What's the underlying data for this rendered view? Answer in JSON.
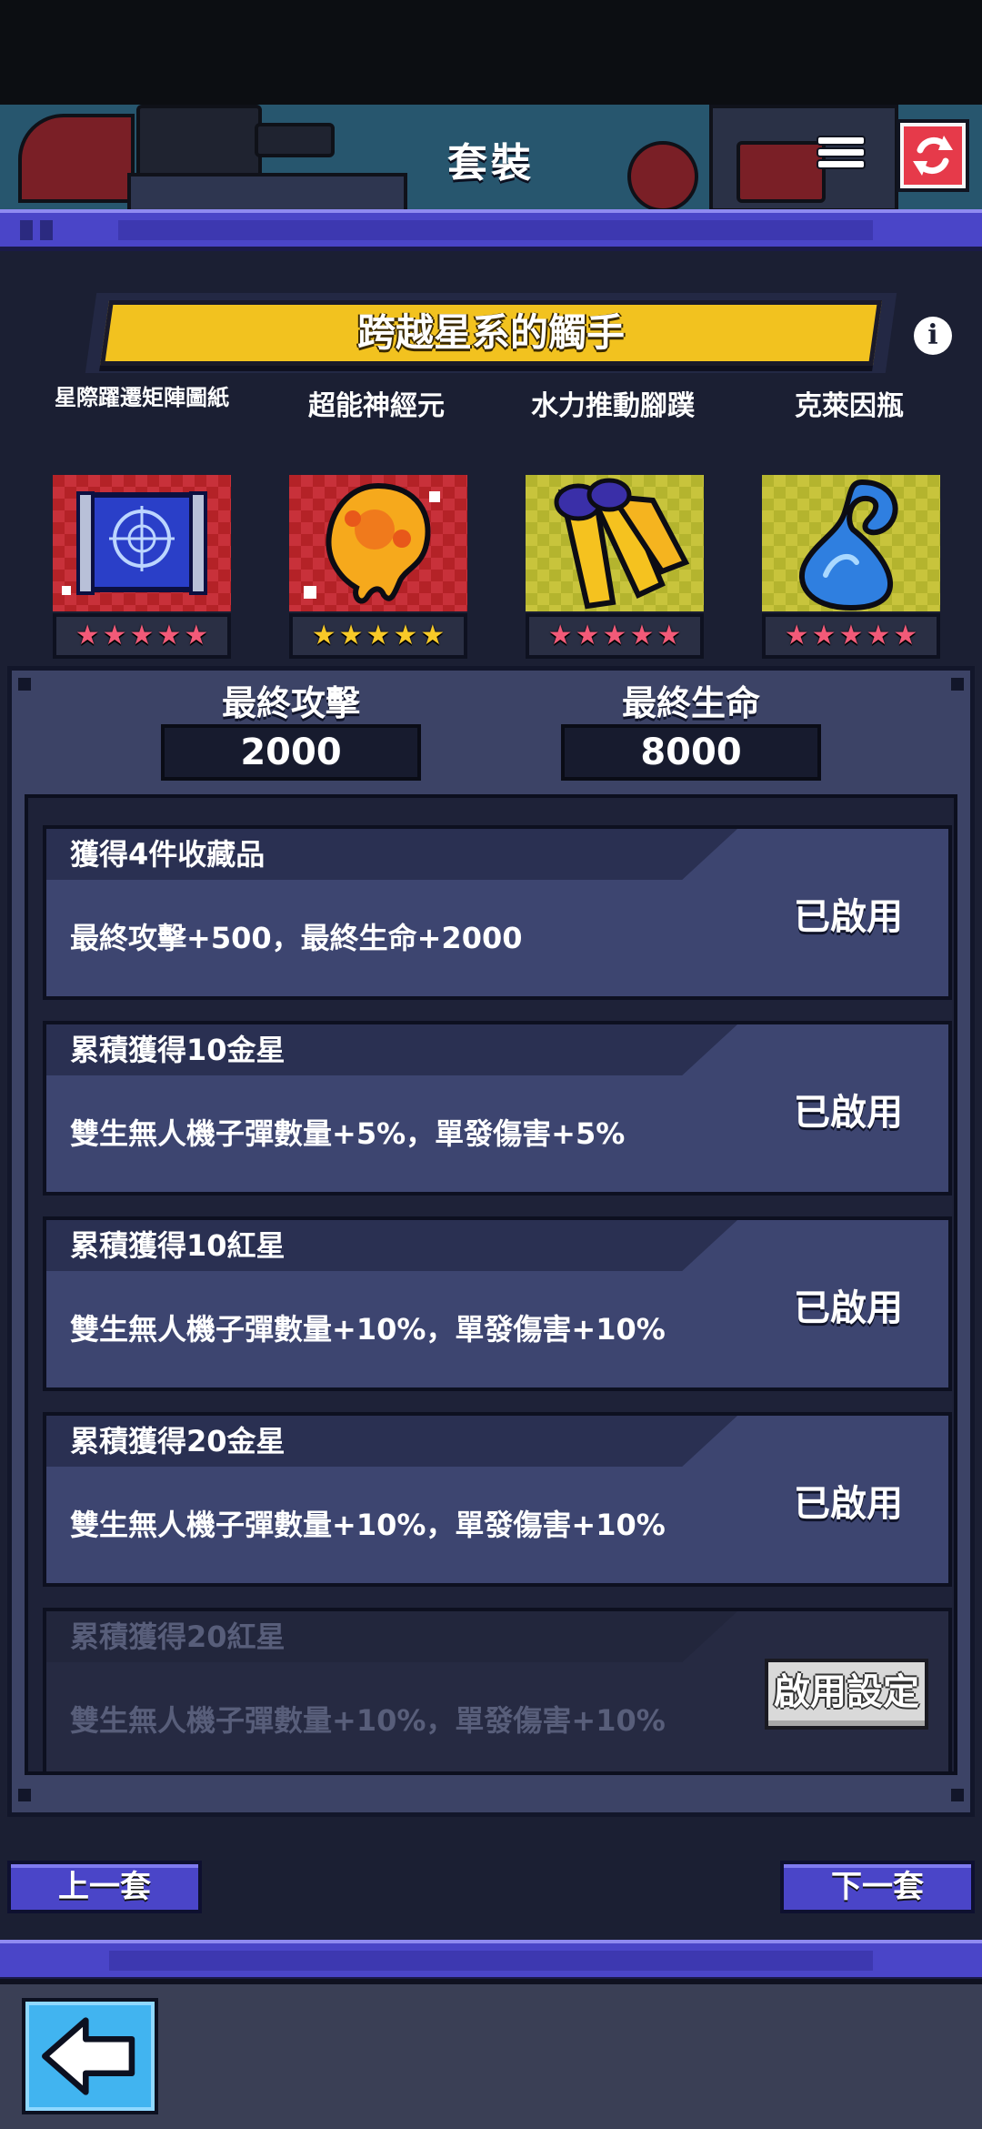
{
  "header": {
    "title": "套裝"
  },
  "banner": {
    "title": "跨越星系的觸手"
  },
  "collectibles": [
    {
      "name": "星際躍遷矩陣圖紙",
      "icon": "blueprint-icon",
      "tile_color": "red",
      "stars": 5,
      "star_color": "red"
    },
    {
      "name": "超能神經元",
      "icon": "neuron-orb-icon",
      "tile_color": "red",
      "stars": 5,
      "star_color": "gold"
    },
    {
      "name": "水力推動腳蹼",
      "icon": "flippers-icon",
      "tile_color": "yellow",
      "stars": 5,
      "star_color": "red"
    },
    {
      "name": "克萊因瓶",
      "icon": "klein-bottle-icon",
      "tile_color": "yellow",
      "stars": 5,
      "star_color": "red"
    }
  ],
  "stats": {
    "attack_label": "最終攻擊",
    "attack_value": "2000",
    "hp_label": "最終生命",
    "hp_value": "8000"
  },
  "bonuses": [
    {
      "title": "獲得4件收藏品",
      "desc": "最終攻擊+500，最終生命+2000",
      "status": "已啟用",
      "active": true
    },
    {
      "title": "累積獲得10金星",
      "desc": "雙生無人機子彈數量+5%，單發傷害+5%",
      "status": "已啟用",
      "active": true
    },
    {
      "title": "累積獲得10紅星",
      "desc": "雙生無人機子彈數量+10%，單發傷害+10%",
      "status": "已啟用",
      "active": true
    },
    {
      "title": "累積獲得20金星",
      "desc": "雙生無人機子彈數量+10%，單發傷害+10%",
      "status": "已啟用",
      "active": true
    },
    {
      "title": "累積獲得20紅星",
      "desc": "雙生無人機子彈數量+10%，單發傷害+10%",
      "status": "啟用設定",
      "active": false
    }
  ],
  "nav": {
    "prev_label": "上一套",
    "next_label": "下一套"
  },
  "colors": {
    "accent_purple": "#4a45c8",
    "banner_yellow": "#f2c21f",
    "refresh_red": "#e63a4a",
    "back_blue": "#41b4f0"
  }
}
